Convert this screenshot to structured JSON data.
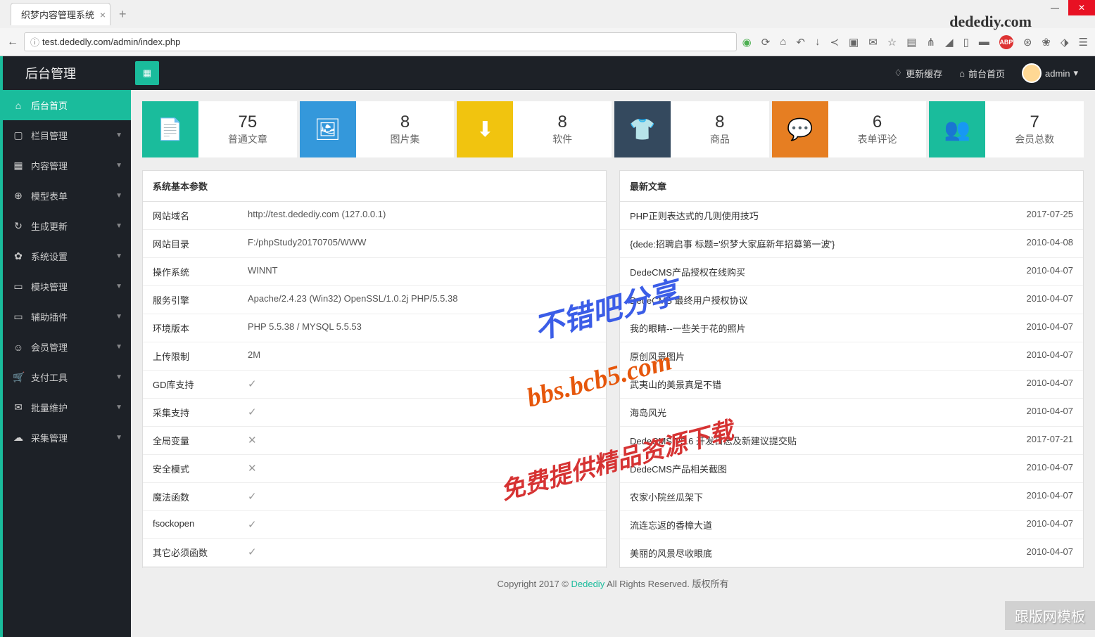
{
  "browser": {
    "tab_title": "织梦内容管理系统",
    "url": "test.dededly.com/admin/index.php",
    "brand": "dedediy.com"
  },
  "header": {
    "logo": "后台管理",
    "refresh_cache": "更新缓存",
    "frontend": "前台首页",
    "user": "admin"
  },
  "sidebar": {
    "items": [
      {
        "label": "后台首页",
        "active": true,
        "icon": "⌂"
      },
      {
        "label": "栏目管理",
        "icon": "▢"
      },
      {
        "label": "内容管理",
        "icon": "▦"
      },
      {
        "label": "模型表单",
        "icon": "⊕"
      },
      {
        "label": "生成更新",
        "icon": "↻"
      },
      {
        "label": "系统设置",
        "icon": "✿"
      },
      {
        "label": "模块管理",
        "icon": "▭"
      },
      {
        "label": "辅助插件",
        "icon": "▭"
      },
      {
        "label": "会员管理",
        "icon": "☺"
      },
      {
        "label": "支付工具",
        "icon": "🛒"
      },
      {
        "label": "批量维护",
        "icon": "✉"
      },
      {
        "label": "采集管理",
        "icon": "☁"
      }
    ]
  },
  "stats": [
    {
      "num": "75",
      "label": "普通文章",
      "color": "c1",
      "icon": "📄"
    },
    {
      "num": "8",
      "label": "图片集",
      "color": "c2",
      "icon": "🖼"
    },
    {
      "num": "8",
      "label": "软件",
      "color": "c3",
      "icon": "⬇"
    },
    {
      "num": "8",
      "label": "商品",
      "color": "c4",
      "icon": "👕"
    },
    {
      "num": "6",
      "label": "表单评论",
      "color": "c5",
      "icon": "💬"
    },
    {
      "num": "7",
      "label": "会员总数",
      "color": "c6",
      "icon": "👥"
    }
  ],
  "param_panel": {
    "title": "系统基本参数",
    "rows": [
      {
        "label": "网站域名",
        "value": "http://test.dedediy.com (127.0.0.1)"
      },
      {
        "label": "网站目录",
        "value": "F:/phpStudy20170705/WWW"
      },
      {
        "label": "操作系统",
        "value": "WINNT"
      },
      {
        "label": "服务引擎",
        "value": "Apache/2.4.23 (Win32) OpenSSL/1.0.2j PHP/5.5.38"
      },
      {
        "label": "环境版本",
        "value": "PHP 5.5.38 / MYSQL 5.5.53"
      },
      {
        "label": "上传限制",
        "value": "2M"
      },
      {
        "label": "GD库支持",
        "value": "✓"
      },
      {
        "label": "采集支持",
        "value": "✓"
      },
      {
        "label": "全局变量",
        "value": "✕"
      },
      {
        "label": "安全模式",
        "value": "✕"
      },
      {
        "label": "魔法函数",
        "value": "✓"
      },
      {
        "label": "fsockopen",
        "value": "✓"
      },
      {
        "label": "其它必须函数",
        "value": "✓"
      }
    ]
  },
  "article_panel": {
    "title": "最新文章",
    "rows": [
      {
        "title": "PHP正则表达式的几则使用技巧",
        "date": "2017-07-25"
      },
      {
        "title": "{dede:招聘启事 标题='织梦大家庭新年招募第一波'}",
        "date": "2010-04-08"
      },
      {
        "title": "DedeCMS产品授权在线购买",
        "date": "2010-04-07"
      },
      {
        "title": "DedeCMS 最终用户授权协议",
        "date": "2010-04-07"
      },
      {
        "title": "我的眼睛--一些关于花的照片",
        "date": "2010-04-07"
      },
      {
        "title": "原创风景图片",
        "date": "2010-04-07"
      },
      {
        "title": "武夷山的美景真是不错",
        "date": "2010-04-07"
      },
      {
        "title": "海岛风光",
        "date": "2010-04-07"
      },
      {
        "title": "DedeCMS V5.6 开发日志及新建议提交贴",
        "date": "2017-07-21"
      },
      {
        "title": "DedeCMS产品相关截图",
        "date": "2010-04-07"
      },
      {
        "title": "农家小院丝瓜架下",
        "date": "2010-04-07"
      },
      {
        "title": "流连忘返的香樟大道",
        "date": "2010-04-07"
      },
      {
        "title": "美丽的风景尽收眼底",
        "date": "2010-04-07"
      }
    ]
  },
  "footer": {
    "pre": "Copyright 2017 © ",
    "link": "Dedediy",
    "post": " All Rights Reserved. 版权所有"
  },
  "watermarks": {
    "w1": "不错吧分享",
    "w2": "bbs.bcb5.com",
    "w3": "免费提供精品资源下载",
    "corner": "跟版网模板"
  }
}
